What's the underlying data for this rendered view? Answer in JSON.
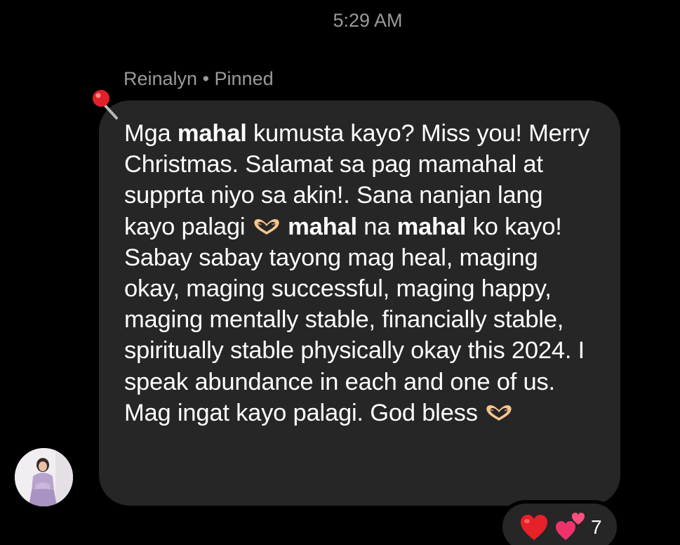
{
  "header": {
    "timestamp": "5:29 AM"
  },
  "message": {
    "sender": "Reinalyn",
    "separator": " • ",
    "status": "Pinned",
    "text_parts": {
      "p1": "Mga ",
      "b1": "mahal",
      "p2": " kumusta kayo? Miss you! Merry Christmas. Salamat sa pag mamahal at supprta niyo sa akin!. Sana nanjan lang kayo palagi ",
      "b2": "mahal",
      "p3": " na ",
      "b3": "mahal",
      "p4": " ko kayo! Sabay sabay tayong mag heal, maging okay, maging successful, maging happy, maging mentally stable, financially stable, spiritually stable physically okay this 2024. I speak abundance in each and one of us. Mag ingat kayo palagi. God bless "
    },
    "inline_emoji": [
      "heart-hands-emoji",
      "heart-hands-emoji"
    ]
  },
  "reactions": {
    "items": [
      "red-heart-emoji",
      "two-hearts-emoji"
    ],
    "count": "7"
  },
  "icons": {
    "pin": "pushpin-icon",
    "avatar": "sender-avatar"
  },
  "colors": {
    "background": "#000000",
    "bubble": "#262626",
    "meta_text": "#9a9a9a",
    "message_text": "#ffffff",
    "heart": "#e8202a",
    "pin_head": "#e0202a"
  }
}
